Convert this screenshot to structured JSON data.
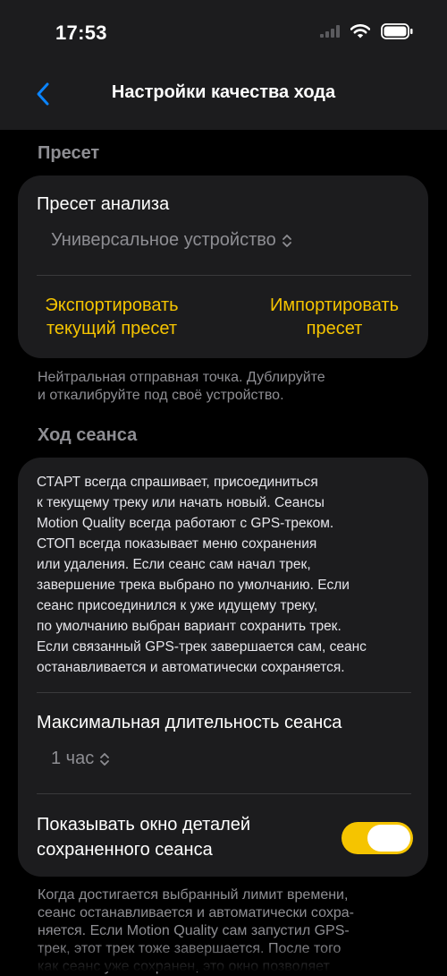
{
  "status": {
    "time": "17:53"
  },
  "nav": {
    "title": "Настройки качества хода"
  },
  "preset_section": {
    "header": "Пресет",
    "label": "Пресет анализа",
    "value": "Универсальное устройство",
    "export_line1": "Экспортировать",
    "export_line2": "текущий пресет",
    "import_line1": "Импортировать",
    "import_line2": "пресет",
    "footer_line1": "Нейтральная отправная точка. Дублируйте",
    "footer_line2": "и откалибруйте под своё устройство."
  },
  "session_section": {
    "header": "Ход сеанса",
    "description": [
      "СТАРТ всегда спрашивает, присоединиться",
      "к текущему треку или начать новый. Сеансы",
      "Motion Quality всегда работают с GPS-треком.",
      "СТОП всегда показывает меню сохранения",
      "или удаления. Если сеанс сам начал трек,",
      "завершение трека выбрано по умолчанию. Если",
      "сеанс присоединился к уже идущему треку,",
      "по умолчанию выбран вариант сохранить трек.",
      "Если связанный GPS-трек завершается сам, сеанс",
      "останавливается и автоматически сохраняется."
    ],
    "max_duration_label": "Максимальная длительность сеанса",
    "max_duration_value": "1 час",
    "show_details_line1": "Показывать окно деталей",
    "show_details_line2": "сохраненного сеанса",
    "show_details_on": true,
    "footer": [
      "Когда достигается выбранный лимит времени,",
      "сеанс останавливается и автоматически сохра-",
      "няется. Если Motion Quality сам запустил GPS-",
      "трек, этот трек тоже завершается. После того",
      "как сеанс уже сохранен, это окно позволяет"
    ]
  },
  "colors": {
    "accent": "#f5c400",
    "back": "#0a84ff",
    "card": "#1c1c1e"
  }
}
